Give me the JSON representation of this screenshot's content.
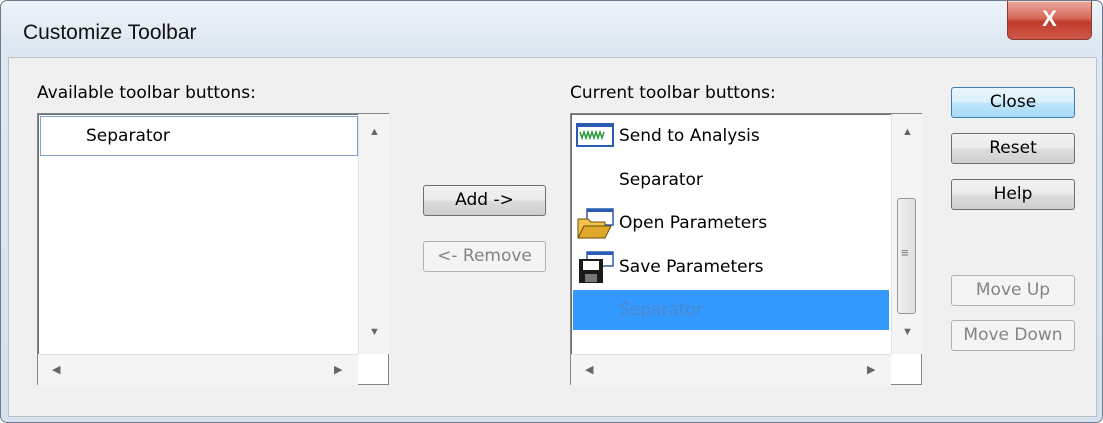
{
  "window": {
    "title": "Customize Toolbar",
    "close_glyph": "X"
  },
  "available": {
    "label": "Available toolbar buttons:",
    "items": [
      {
        "label": "Separator"
      }
    ]
  },
  "current": {
    "label": "Current toolbar buttons:",
    "items": [
      {
        "label": "Send to Analysis",
        "icon": "send-to-analysis-icon"
      },
      {
        "label": "Separator"
      },
      {
        "label": "Open Parameters",
        "icon": "open-folder-icon"
      },
      {
        "label": "Save Parameters",
        "icon": "floppy-disk-icon"
      },
      {
        "label": "Separator",
        "selected": true
      }
    ]
  },
  "buttons": {
    "add": "Add ->",
    "remove": "<- Remove",
    "close": "Close",
    "reset": "Reset",
    "help": "Help",
    "move_up": "Move Up",
    "move_down": "Move Down"
  },
  "colors": {
    "selection": "#3399ff",
    "close_button": "#c0392b",
    "default_button": "#bee6fd"
  }
}
